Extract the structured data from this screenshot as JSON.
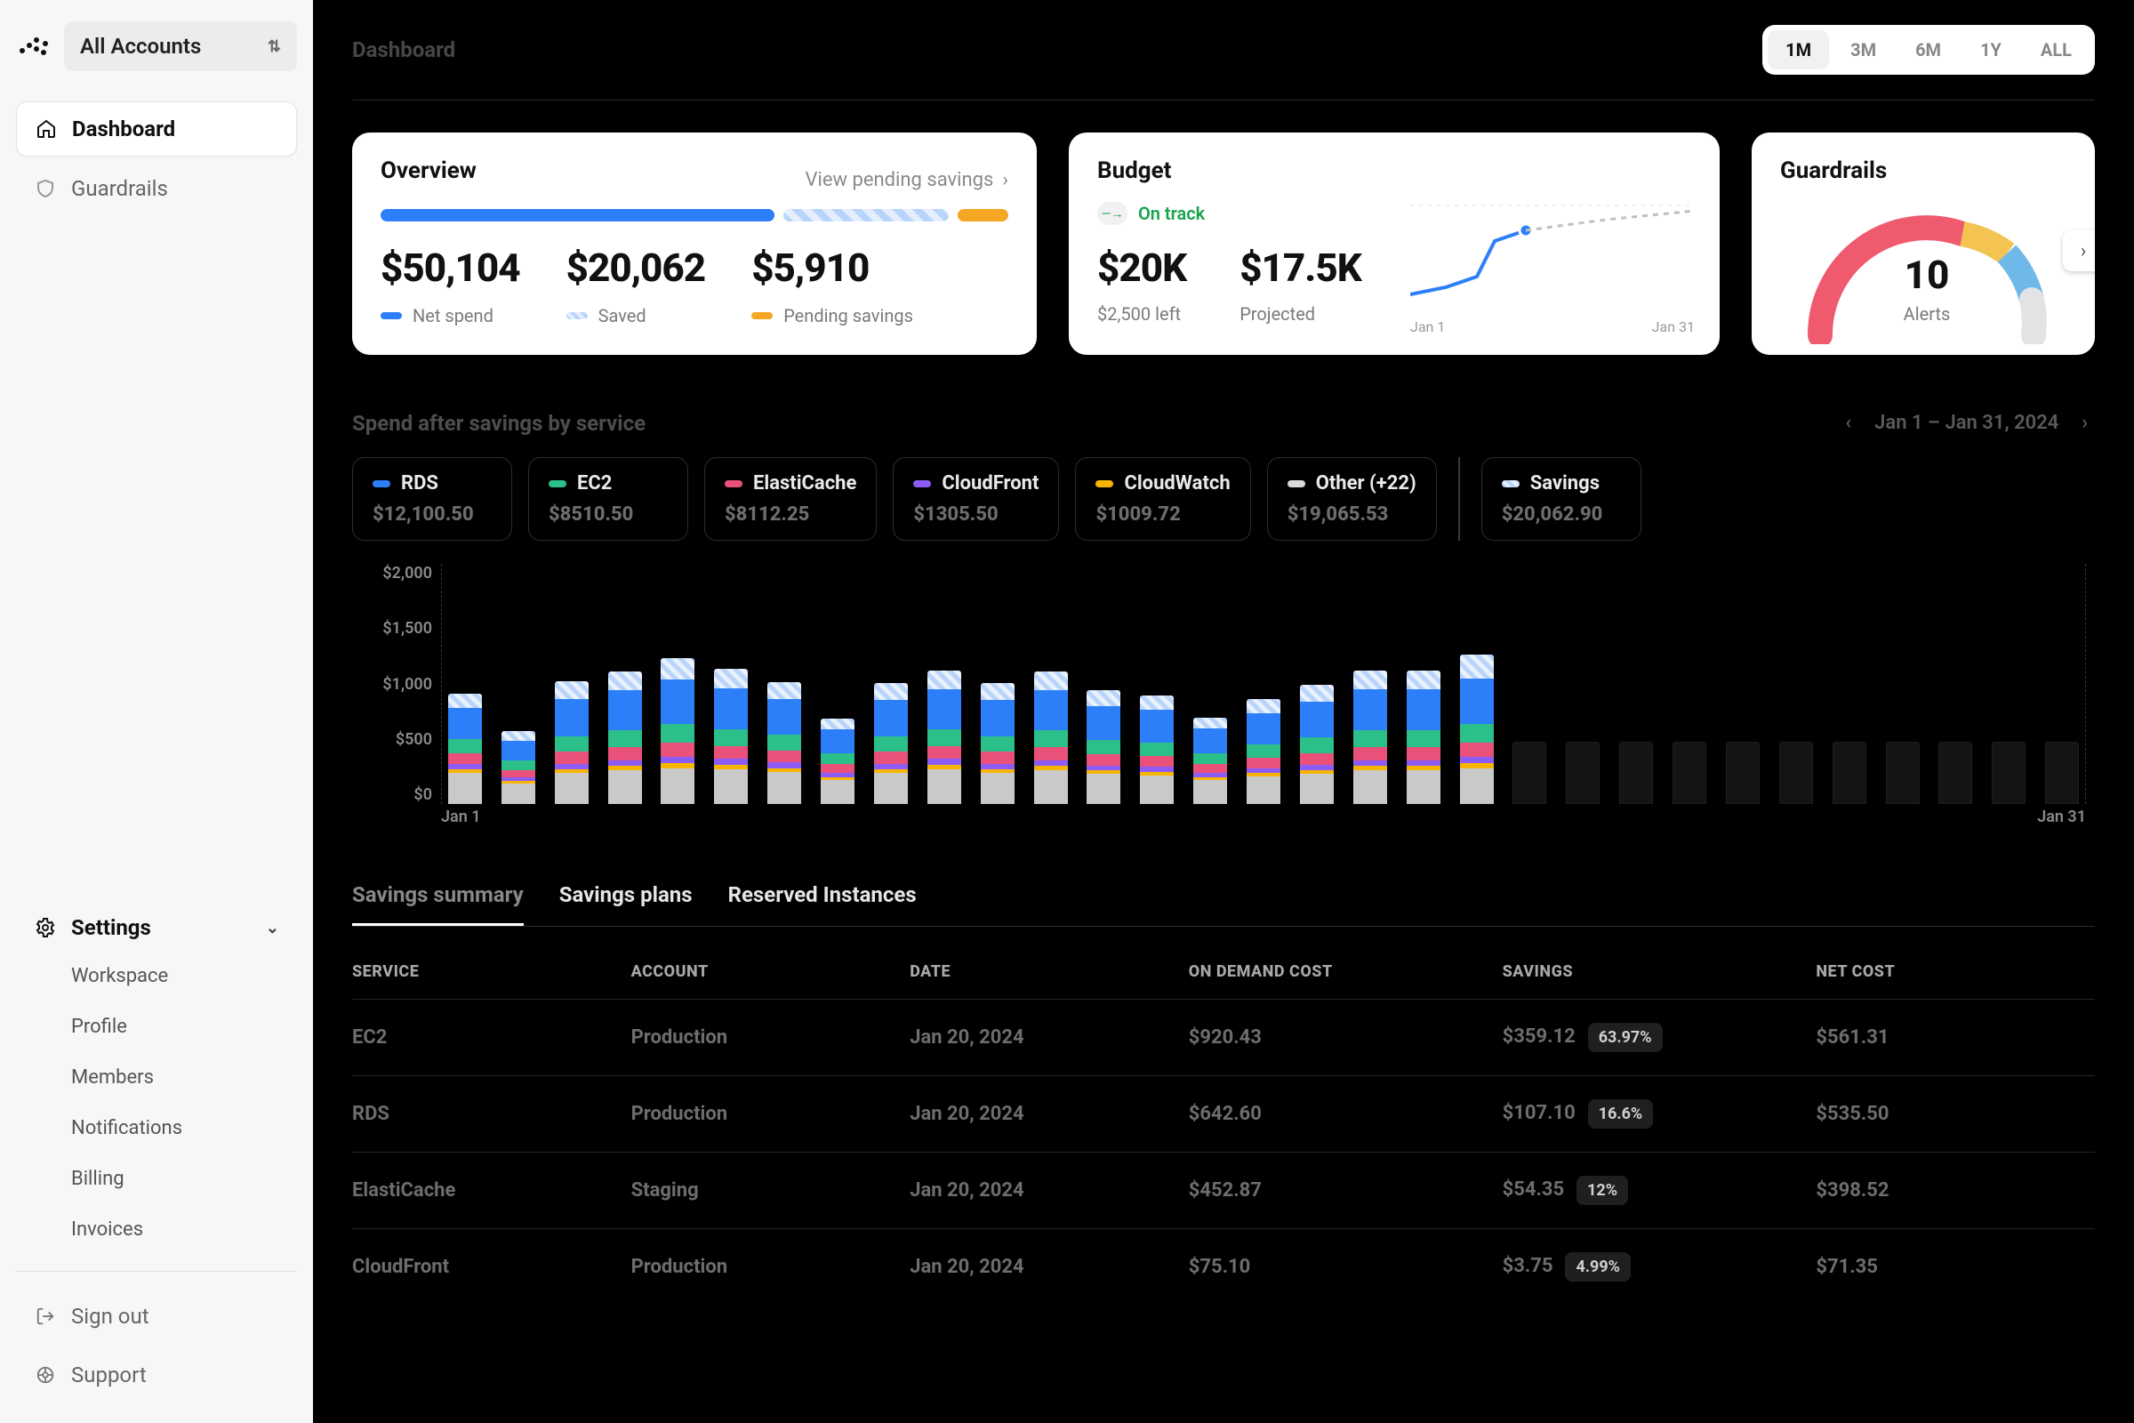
{
  "sidebar": {
    "account_selector": "All Accounts",
    "nav": [
      {
        "icon": "home",
        "label": "Dashboard",
        "active": true
      },
      {
        "icon": "shield",
        "label": "Guardrails",
        "active": false
      }
    ],
    "settings_label": "Settings",
    "settings_items": [
      "Workspace",
      "Profile",
      "Members",
      "Notifications",
      "Billing",
      "Invoices"
    ],
    "signout": "Sign out",
    "support": "Support"
  },
  "topbar": {
    "breadcrumb": "Dashboard",
    "ranges": [
      "1M",
      "3M",
      "6M",
      "1Y",
      "ALL"
    ],
    "active_range": "1M"
  },
  "overview": {
    "title": "Overview",
    "link": "View pending savings",
    "net_spend": {
      "value": "$50,104",
      "label": "Net spend"
    },
    "saved": {
      "value": "$20,062",
      "label": "Saved"
    },
    "pending": {
      "value": "$5,910",
      "label": "Pending savings"
    }
  },
  "budget": {
    "title": "Budget",
    "status": "On track",
    "amount": {
      "value": "$20K",
      "sub": "$2,500 left"
    },
    "projected": {
      "value": "$17.5K",
      "sub": "Projected"
    },
    "x_start": "Jan 1",
    "x_end": "Jan 31"
  },
  "guardrails": {
    "title": "Guardrails",
    "count": "10",
    "label": "Alerts"
  },
  "spend_section": {
    "title": "Spend after savings by service",
    "date_range": "Jan 1 – Jan 31, 2024"
  },
  "legend": [
    {
      "name": "RDS",
      "color": "#2d7ff9",
      "value": "$12,100.50"
    },
    {
      "name": "EC2",
      "color": "#2bbf8a",
      "value": "$8510.50"
    },
    {
      "name": "ElastiCache",
      "color": "#e9517a",
      "value": "$8112.25"
    },
    {
      "name": "CloudFront",
      "color": "#8d5cf6",
      "value": "$1305.50"
    },
    {
      "name": "CloudWatch",
      "color": "#f7b500",
      "value": "$1009.72"
    },
    {
      "name": "Other (+22)",
      "color": "#d9d9d9",
      "value": "$19,065.53"
    }
  ],
  "savings_legend": {
    "name": "Savings",
    "color": "#bcd7fb",
    "value": "$20,062.90"
  },
  "chart_data": {
    "type": "bar",
    "title": "Spend after savings by service",
    "xlabel": "",
    "ylabel": "",
    "ylim": [
      0,
      2000
    ],
    "y_ticks": [
      "$2,000",
      "$1,500",
      "$1,000",
      "$500",
      "$0"
    ],
    "x_start": "Jan 1",
    "x_end": "Jan 31",
    "categories": [
      "1",
      "2",
      "3",
      "4",
      "5",
      "6",
      "7",
      "8",
      "9",
      "10",
      "11",
      "12",
      "13",
      "14",
      "15",
      "16",
      "17",
      "18",
      "19",
      "20",
      "21",
      "22",
      "23",
      "24",
      "25",
      "26",
      "27",
      "28",
      "29",
      "30",
      "31"
    ],
    "series": [
      {
        "name": "Other",
        "color": "#c9c9c9",
        "values": [
          260,
          170,
          260,
          280,
          300,
          290,
          270,
          200,
          260,
          290,
          260,
          280,
          250,
          240,
          200,
          230,
          250,
          280,
          280,
          300,
          0,
          0,
          0,
          0,
          0,
          0,
          0,
          0,
          0,
          0,
          0
        ]
      },
      {
        "name": "CloudWatch",
        "color": "#f7b500",
        "values": [
          30,
          20,
          30,
          35,
          40,
          35,
          30,
          25,
          30,
          35,
          30,
          35,
          30,
          28,
          25,
          28,
          30,
          35,
          35,
          40,
          0,
          0,
          0,
          0,
          0,
          0,
          0,
          0,
          0,
          0,
          0
        ]
      },
      {
        "name": "CloudFront",
        "color": "#8d5cf6",
        "values": [
          40,
          30,
          45,
          50,
          55,
          50,
          45,
          35,
          45,
          50,
          45,
          50,
          40,
          40,
          35,
          40,
          45,
          50,
          50,
          55,
          0,
          0,
          0,
          0,
          0,
          0,
          0,
          0,
          0,
          0,
          0
        ]
      },
      {
        "name": "ElastiCache",
        "color": "#e9517a",
        "values": [
          90,
          60,
          100,
          110,
          120,
          110,
          100,
          70,
          100,
          110,
          100,
          110,
          95,
          90,
          70,
          90,
          100,
          110,
          110,
          120,
          0,
          0,
          0,
          0,
          0,
          0,
          0,
          0,
          0,
          0,
          0
        ]
      },
      {
        "name": "EC2",
        "color": "#2bbf8a",
        "values": [
          120,
          80,
          130,
          140,
          150,
          140,
          130,
          90,
          130,
          140,
          130,
          140,
          120,
          115,
          90,
          110,
          130,
          140,
          140,
          150,
          0,
          0,
          0,
          0,
          0,
          0,
          0,
          0,
          0,
          0,
          0
        ]
      },
      {
        "name": "RDS",
        "color": "#2d7ff9",
        "values": [
          260,
          170,
          310,
          330,
          370,
          340,
          300,
          200,
          300,
          330,
          300,
          330,
          280,
          270,
          210,
          260,
          300,
          340,
          340,
          380,
          0,
          0,
          0,
          0,
          0,
          0,
          0,
          0,
          0,
          0,
          0
        ]
      },
      {
        "name": "Savings",
        "color": "hatch-blue",
        "values": [
          120,
          80,
          150,
          160,
          180,
          160,
          140,
          90,
          140,
          160,
          140,
          160,
          130,
          120,
          90,
          120,
          140,
          160,
          160,
          200,
          0,
          0,
          0,
          0,
          0,
          0,
          0,
          0,
          0,
          0,
          0
        ]
      }
    ],
    "future_placeholder_from_index": 20
  },
  "tabs": [
    "Savings summary",
    "Savings plans",
    "Reserved Instances"
  ],
  "active_tab": "Savings summary",
  "table": {
    "columns": [
      "SERVICE",
      "ACCOUNT",
      "DATE",
      "ON DEMAND COST",
      "SAVINGS",
      "NET COST"
    ],
    "rows": [
      {
        "service": "EC2",
        "account": "Production",
        "date": "Jan 20, 2024",
        "odc": "$920.43",
        "savings": "$359.12",
        "pct": "63.97%",
        "net": "$561.31"
      },
      {
        "service": "RDS",
        "account": "Production",
        "date": "Jan 20, 2024",
        "odc": "$642.60",
        "savings": "$107.10",
        "pct": "16.6%",
        "net": "$535.50"
      },
      {
        "service": "ElastiCache",
        "account": "Staging",
        "date": "Jan 20, 2024",
        "odc": "$452.87",
        "savings": "$54.35",
        "pct": "12%",
        "net": "$398.52"
      },
      {
        "service": "CloudFront",
        "account": "Production",
        "date": "Jan 20, 2024",
        "odc": "$75.10",
        "savings": "$3.75",
        "pct": "4.99%",
        "net": "$71.35"
      }
    ]
  }
}
